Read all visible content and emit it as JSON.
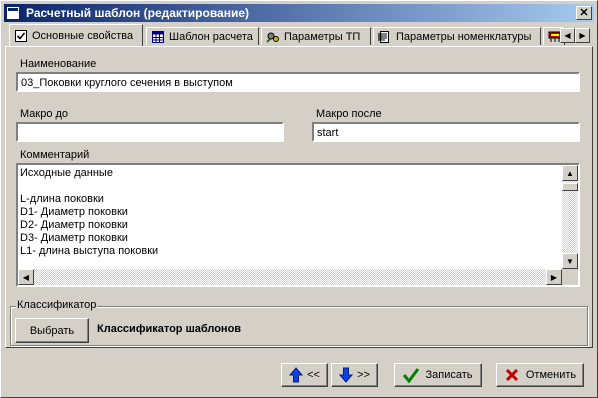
{
  "window": {
    "title": "Расчетный шаблон (редактирование)",
    "close_glyph": "✕"
  },
  "tabs": [
    {
      "label": "Основные свойства",
      "icon": "checkbox-icon",
      "active": true
    },
    {
      "label": "Шаблон расчета",
      "icon": "table-icon"
    },
    {
      "label": "Параметры ТП",
      "icon": "gears-icon"
    },
    {
      "label": "Параметры номенклатуры",
      "icon": "document-icon"
    },
    {
      "label": "",
      "icon": "network-icon"
    }
  ],
  "tab_scroll": {
    "left": "◀",
    "right": "▶"
  },
  "form": {
    "name_label": "Наименование",
    "name_value": "03_Поковки круглого сечения в выступом",
    "macro_before_label": "Макро до",
    "macro_before_value": "",
    "macro_after_label": "Макро после",
    "macro_after_value": "start",
    "comment_label": "Комментарий",
    "comment_lines": [
      "Исходные данные",
      "",
      "L-длина поковки",
      "D1- Диаметр поковки",
      "D2- Диаметр поковки",
      "D3- Диаметр поковки",
      "L1- длина выступа поковки"
    ]
  },
  "classifier": {
    "legend": "Классификатор",
    "select_button": "Выбрать",
    "value": "Классификатор шаблонов"
  },
  "footer": {
    "prev_label": "<<",
    "next_label": ">>",
    "save_label": "Записать",
    "cancel_label": "Отменить"
  },
  "colors": {
    "titlebar_start": "#0a246a",
    "titlebar_end": "#a6caf0",
    "face": "#d4d0c8"
  }
}
